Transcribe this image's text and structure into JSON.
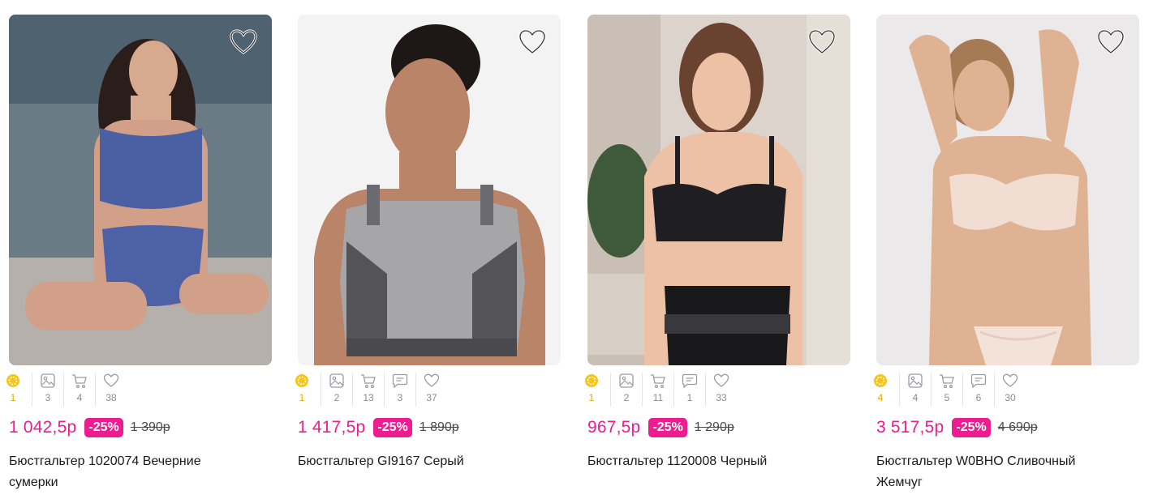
{
  "products": [
    {
      "price": "1 042,5р",
      "discount": "-25%",
      "old_price": "1 390р",
      "title": "Бюстгальтер 1020074 Вечерние сумерки",
      "stats": {
        "coins": "1",
        "photos": "3",
        "cart": "4",
        "reviews": null,
        "likes": "38"
      },
      "icons": [
        "coin-icon",
        "photo-icon",
        "cart-icon",
        "heart-outline-icon"
      ]
    },
    {
      "price": "1 417,5р",
      "discount": "-25%",
      "old_price": "1 890р",
      "title": "Бюстгальтер GI9167 Серый",
      "stats": {
        "coins": "1",
        "photos": "2",
        "cart": "13",
        "reviews": "3",
        "likes": "37"
      }
    },
    {
      "price": "967,5р",
      "discount": "-25%",
      "old_price": "1 290р",
      "title": "Бюстгальтер 1120008 Черный",
      "stats": {
        "coins": "1",
        "photos": "2",
        "cart": "11",
        "reviews": "1",
        "likes": "33"
      }
    },
    {
      "price": "3 517,5р",
      "discount": "-25%",
      "old_price": "4 690р",
      "title": "Бюстгальтер W0BHO Сливочный Жемчуг",
      "stats": {
        "coins": "4",
        "photos": "4",
        "cart": "5",
        "reviews": "6",
        "likes": "30"
      }
    }
  ],
  "colors": {
    "accent": "#ed1c8f",
    "coin": "#f5c518",
    "muted": "#8a8a95"
  }
}
